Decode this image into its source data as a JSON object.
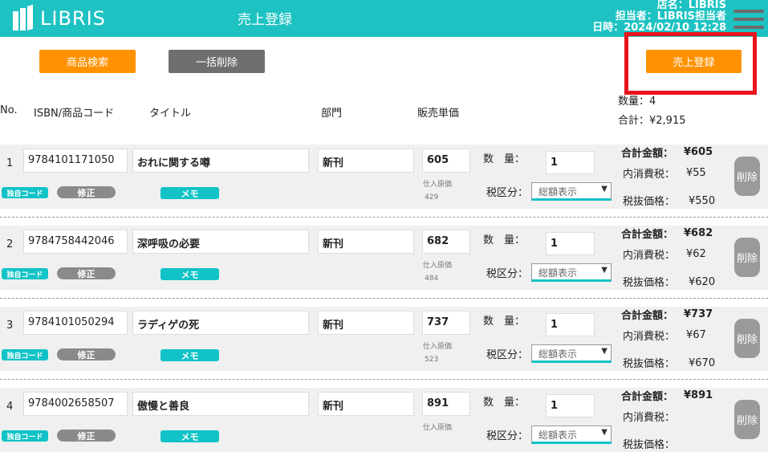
{
  "header": {
    "logo_text": "LIBRIS",
    "title": "売上登録",
    "store": "店名：LIBRIS",
    "staff": "担当者：LIBRIS担当者",
    "datetime": "日時：2024/02/10 12:28"
  },
  "toolbar": {
    "search_label": "商品検索",
    "bulk_delete_label": "一括削除",
    "register_label": "売上登録"
  },
  "summary": {
    "quantity": "数量：4",
    "total": "合計：¥2,915"
  },
  "columns": {
    "no": "No.",
    "isbn": "ISBN/商品コード",
    "title": "タイトル",
    "dept": "部門",
    "price": "販売単価"
  },
  "labels": {
    "cost_label": "仕入原価",
    "qty_label": "数　量：",
    "tax_label": "税区分：",
    "total_label": "合計金額：",
    "inner_tax_label": "内消費税：",
    "excl_label": "税抜価格：",
    "delete": "削除",
    "own_code": "独自コード",
    "edit": "修正",
    "memo": "メモ"
  },
  "tax_options": [
    "総額表示"
  ],
  "rows": [
    {
      "no": "1",
      "isbn": "9784101171050",
      "title": "おれに関する噂",
      "dept": "新刊",
      "price": "605",
      "cost": "429",
      "qty": "1",
      "tax": "総額表示",
      "total": "¥605",
      "inner_tax": "¥55",
      "excl": "¥550"
    },
    {
      "no": "2",
      "isbn": "9784758442046",
      "title": "深呼吸の必要",
      "dept": "新刊",
      "price": "682",
      "cost": "484",
      "qty": "1",
      "tax": "総額表示",
      "total": "¥682",
      "inner_tax": "¥62",
      "excl": "¥620"
    },
    {
      "no": "3",
      "isbn": "9784101050294",
      "title": "ラディゲの死",
      "dept": "新刊",
      "price": "737",
      "cost": "523",
      "qty": "1",
      "tax": "総額表示",
      "total": "¥737",
      "inner_tax": "¥67",
      "excl": "¥670"
    },
    {
      "no": "4",
      "isbn": "9784002658507",
      "title": "傲慢と善良",
      "dept": "新刊",
      "price": "891",
      "cost": "",
      "qty": "1",
      "tax": "総額表示",
      "total": "¥891",
      "inner_tax": "",
      "excl": ""
    }
  ],
  "colors": {
    "header_bg": "#1ec2c2",
    "accent_orange": "#ff9200",
    "highlight_red": "#e8141d"
  }
}
